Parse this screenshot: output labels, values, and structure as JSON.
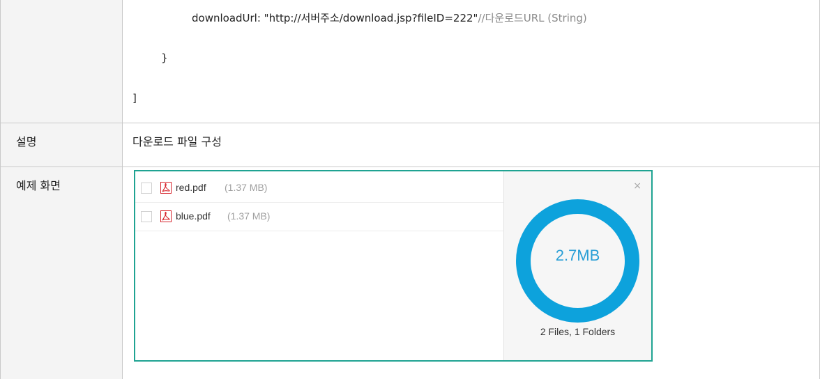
{
  "code_block": {
    "line1": "downloadUrl: \"http://서버주소/download.jsp?fileID=222\"",
    "line1_comment": "//다운로드URL (String)",
    "line2": "}",
    "line3": "]"
  },
  "description": {
    "label": "설명",
    "value": "다운로드 파일 구성"
  },
  "example": {
    "label": "예제 화면"
  },
  "widget": {
    "files": [
      {
        "name": "red.pdf",
        "size": "(1.37 MB)",
        "icon": "pdf-icon"
      },
      {
        "name": "blue.pdf",
        "size": "(1.37 MB)",
        "icon": "pdf-icon"
      }
    ],
    "close_icon": "×",
    "total_size": "2.7MB",
    "counts": "2 Files, 1 Folders",
    "colors": {
      "border": "#1fa392",
      "donut": "#0da2dc",
      "pdf_icon": "#d6232b",
      "total_text": "#2a9fd6"
    }
  }
}
